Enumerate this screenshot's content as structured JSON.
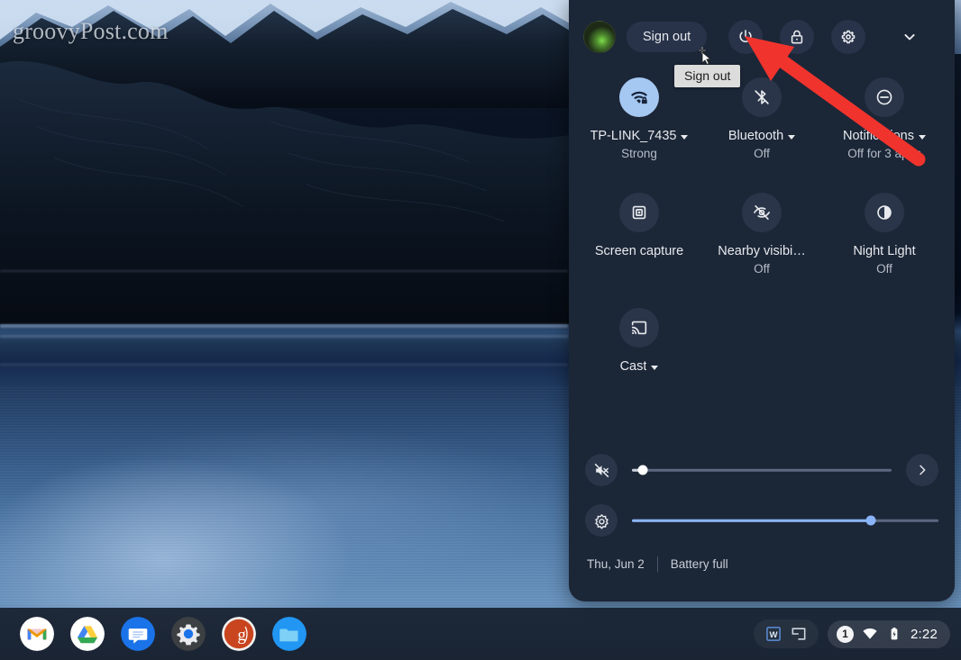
{
  "watermark": "groovyPost.com",
  "quick_settings": {
    "top_bar": {
      "avatar_name": "user-avatar",
      "sign_out_label": "Sign out",
      "tooltip_label": "Sign out",
      "power_label": "power-icon",
      "lock_label": "lock-icon",
      "settings_label": "gear-icon",
      "collapse_label": "chevron-down-icon"
    },
    "tiles": [
      {
        "icon": "wifi-lock-icon",
        "label": "TP-LINK_7435",
        "sub": "Strong",
        "caret": true,
        "active": true
      },
      {
        "icon": "bluetooth-off-icon",
        "label": "Bluetooth",
        "sub": "Off",
        "caret": true,
        "active": false
      },
      {
        "icon": "do-not-disturb-icon",
        "label": "Notifications",
        "sub": "Off for 3 apps",
        "caret": true,
        "active": false
      },
      {
        "icon": "screen-capture-icon",
        "label": "Screen capture",
        "sub": "",
        "caret": false,
        "active": false
      },
      {
        "icon": "nearby-visibility-off-icon",
        "label": "Nearby visibi…",
        "sub": "Off",
        "caret": false,
        "active": false
      },
      {
        "icon": "night-light-icon",
        "label": "Night Light",
        "sub": "Off",
        "caret": false,
        "active": false
      },
      {
        "icon": "cast-icon",
        "label": "Cast",
        "sub": "",
        "caret": true,
        "active": false
      }
    ],
    "volume": {
      "icon": "volume-mute-icon",
      "value": 4,
      "expand_icon": "chevron-right-icon"
    },
    "brightness": {
      "icon": "brightness-icon",
      "value": 78
    },
    "footer": {
      "date": "Thu, Jun 2",
      "battery": "Battery full"
    }
  },
  "annotation": {
    "arrow_color": "#f0342d"
  },
  "shelf": {
    "apps": [
      {
        "name": "gmail",
        "label": "Gmail"
      },
      {
        "name": "google-drive",
        "label": "Google Drive"
      },
      {
        "name": "google-chat",
        "label": "Chat"
      },
      {
        "name": "settings",
        "label": "Settings"
      },
      {
        "name": "groovypost",
        "label": "groovyPost"
      },
      {
        "name": "files",
        "label": "Files"
      }
    ],
    "window_group": {
      "word_label": "W",
      "split_label": "split-window-icon"
    },
    "tray": {
      "notification_count": "1",
      "wifi": "wifi-icon",
      "battery": "battery-charging-icon",
      "time": "2:22"
    }
  }
}
